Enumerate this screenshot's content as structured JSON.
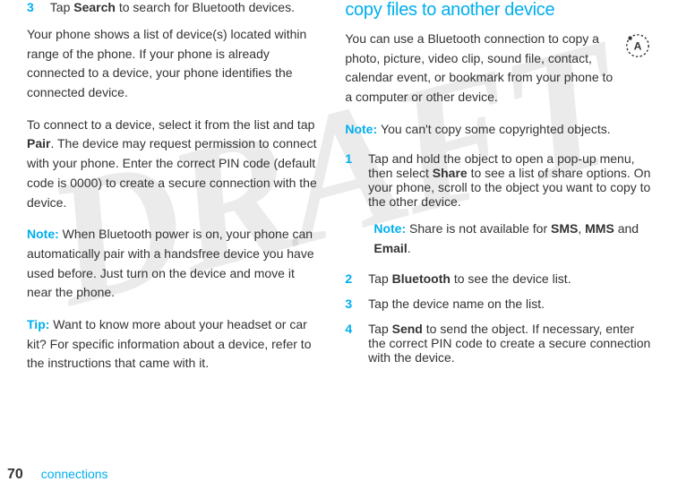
{
  "watermark": "DRAFT",
  "left": {
    "step3_num": "3",
    "step3_prefix": "Tap ",
    "step3_bold": "Search",
    "step3_suffix": " to search for Bluetooth devices.",
    "para1": "Your phone shows a list of device(s) located within range of the phone. If your phone is already connected to a device, your phone identifies the connected device.",
    "para2_prefix": "To connect to a device, select it from the list and tap ",
    "para2_bold": "Pair",
    "para2_suffix": ". The device may request permission to connect with your phone. Enter the correct PIN code (default code is 0000) to create a secure connection with the device.",
    "note_label": "Note: ",
    "note_text": "When Bluetooth power is on, your phone can automatically pair with a handsfree device you have used before. Just turn on the device and move it near the phone.",
    "tip_label": "Tip: ",
    "tip_text": "Want to know more about your headset or car kit? For specific information about a device, refer to the instructions that came with it."
  },
  "right": {
    "heading": "copy files to another device",
    "para1": "You can use a Bluetooth connection to copy a photo, picture, video clip, sound file, contact, calendar event, or bookmark from your phone to a computer or other device.",
    "note_label": "Note: ",
    "note_text": "You can't copy some copyrighted objects.",
    "step1_num": "1",
    "step1_prefix": "Tap and hold the object to open a pop-up menu, then select ",
    "step1_bold": "Share",
    "step1_suffix": " to see a list of share options. On your phone, scroll to the object you want to copy to the other device.",
    "subnote_label": "Note: ",
    "subnote_prefix": "Share is not available for ",
    "subnote_b1": "SMS",
    "subnote_mid1": ", ",
    "subnote_b2": "MMS",
    "subnote_mid2": " and ",
    "subnote_b3": "Email",
    "subnote_suffix": ".",
    "step2_num": "2",
    "step2_prefix": "Tap ",
    "step2_bold": "Bluetooth",
    "step2_suffix": " to see the device list.",
    "step3_num": "3",
    "step3_text": "Tap the device name on the list.",
    "step4_num": "4",
    "step4_prefix": "Tap ",
    "step4_bold": "Send",
    "step4_suffix": " to send the object. If necessary, enter the correct PIN code to create a secure connection with the device."
  },
  "footer": {
    "page": "70",
    "title": "connections"
  }
}
